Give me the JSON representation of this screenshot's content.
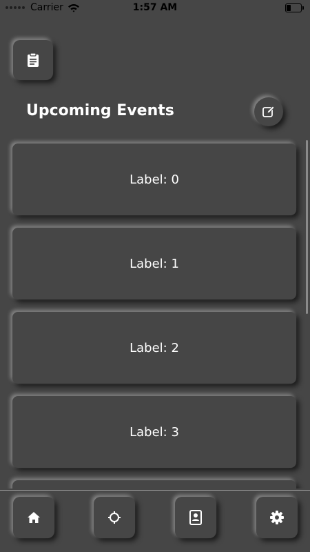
{
  "status_bar": {
    "carrier": "Carrier",
    "time": "1:57 AM"
  },
  "header": {
    "title": "Upcoming Events",
    "top_left_icon": "clipboard-icon",
    "edit_icon": "edit-icon"
  },
  "events": [
    {
      "label": "Label: 0"
    },
    {
      "label": "Label: 1"
    },
    {
      "label": "Label: 2"
    },
    {
      "label": "Label: 3"
    },
    {
      "label": ""
    }
  ],
  "tab_bar": {
    "items": [
      {
        "icon": "home-icon"
      },
      {
        "icon": "crosshair-icon"
      },
      {
        "icon": "contact-card-icon"
      },
      {
        "icon": "gear-icon"
      }
    ]
  },
  "colors": {
    "background": "#464646",
    "text": "#ffffff"
  }
}
